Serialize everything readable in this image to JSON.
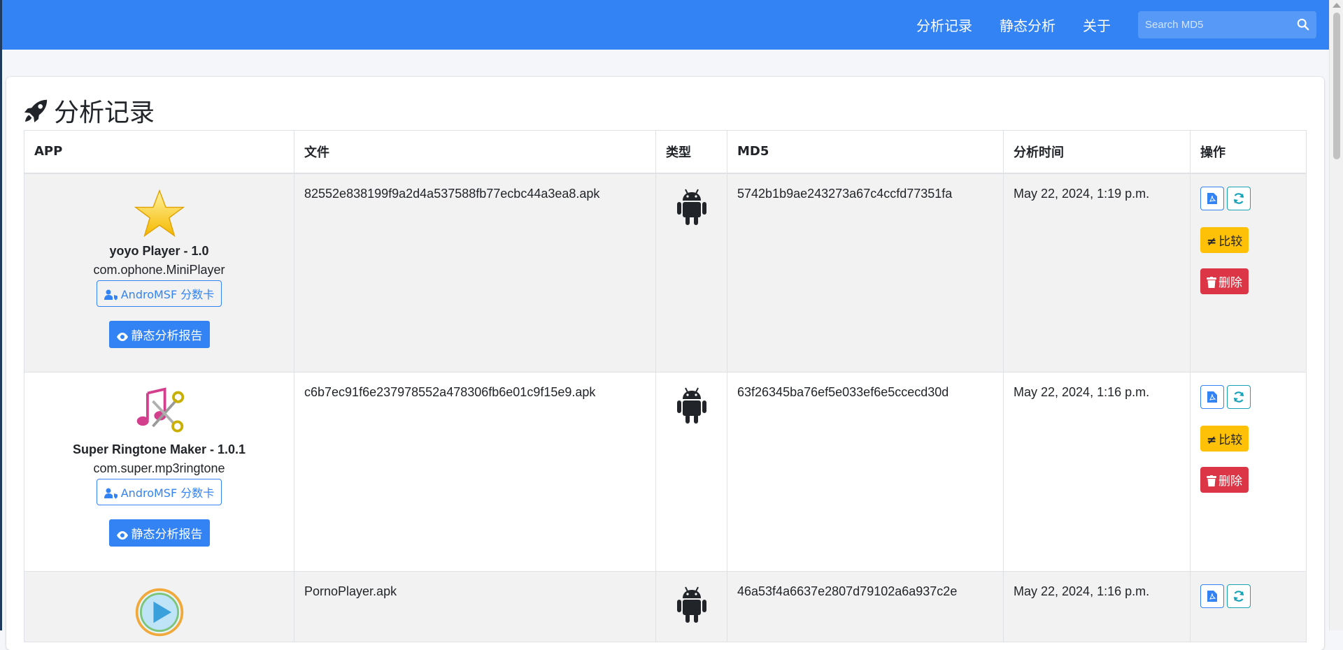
{
  "nav": {
    "links": [
      "分析记录",
      "静态分析",
      "关于"
    ],
    "search_placeholder": "Search MD5"
  },
  "page": {
    "title": "分析记录"
  },
  "table": {
    "headers": [
      "APP",
      "文件",
      "类型",
      "MD5",
      "分析时间",
      "操作"
    ],
    "rows": [
      {
        "icon": "star-icon",
        "app_name": "yoyo Player - 1.0",
        "package": "com.ophone.MiniPlayer",
        "scorecard_label": "AndroMSF 分数卡",
        "report_label": "静态分析报告",
        "file": "82552e838199f9a2d4a537588fb77ecbc44a3ea8.apk",
        "type_icon": "android-icon",
        "md5": "5742b1b9ae243273a67c4ccfd77351fa",
        "time": "May 22, 2024, 1:19 p.m.",
        "compare_label": "比较",
        "delete_label": "删除"
      },
      {
        "icon": "music-scissors-icon",
        "app_name": "Super Ringtone Maker - 1.0.1",
        "package": "com.super.mp3ringtone",
        "scorecard_label": "AndroMSF 分数卡",
        "report_label": "静态分析报告",
        "file": "c6b7ec91f6e237978552a478306fb6e01c9f15e9.apk",
        "type_icon": "android-icon",
        "md5": "63f26345ba76ef5e033ef6e5ccecd30d",
        "time": "May 22, 2024, 1:16 p.m.",
        "compare_label": "比较",
        "delete_label": "删除"
      },
      {
        "icon": "play-icon",
        "file": "PornoPlayer.apk",
        "type_icon": "android-icon",
        "md5": "46a53f4a6637e2807d79102a6a937c2e",
        "time": "May 22, 2024, 1:16 p.m."
      }
    ]
  },
  "colors": {
    "navbar": "#3383f5",
    "primary": "#3383f5",
    "warning": "#ffc107",
    "danger": "#dc3545",
    "info": "#17a2b8"
  }
}
